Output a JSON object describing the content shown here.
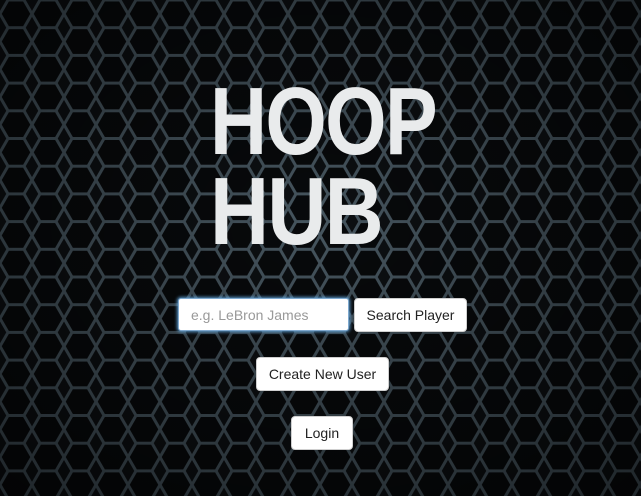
{
  "logo": {
    "line1": "HOOP",
    "line2": "HUB"
  },
  "search": {
    "placeholder": "e.g. LeBron James",
    "value": "",
    "button_label": "Search Player"
  },
  "actions": {
    "create_user_label": "Create New User",
    "login_label": "Login"
  },
  "colors": {
    "background": "#0d1013",
    "hex_stroke": "#4a5a64",
    "logo": "#e9ebec",
    "input_focus": "#66afe9"
  }
}
